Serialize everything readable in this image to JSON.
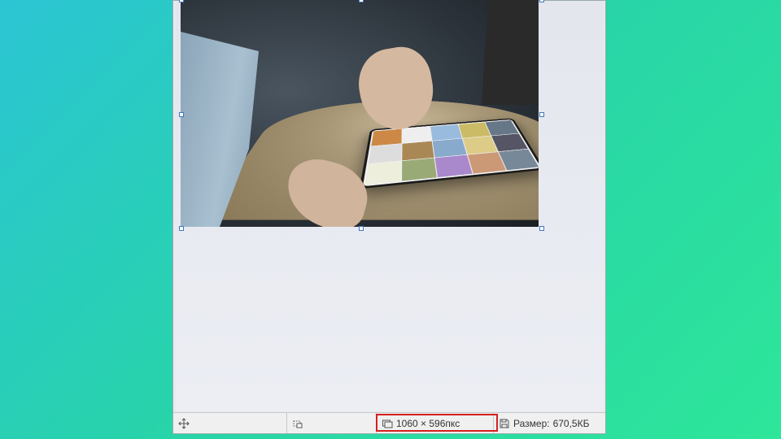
{
  "statusbar": {
    "cursor_label": "",
    "selection_label": "",
    "dimensions_icon": "screen-size-icon",
    "dimensions_text": "1060 × 596пкс",
    "filesize_icon": "floppy-icon",
    "filesize_label": "Размер:",
    "filesize_value": "670,5КБ"
  },
  "colors": {
    "highlight": "#d42020",
    "canvas_bg": "#e8eaf0"
  }
}
